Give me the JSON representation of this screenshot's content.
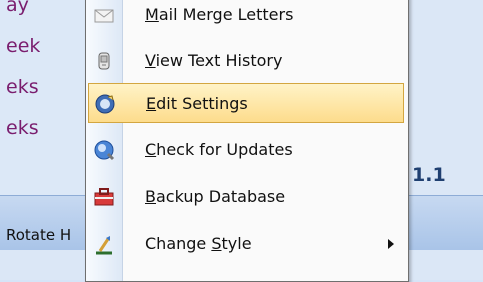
{
  "background": {
    "list_items": [
      "ay",
      "eek",
      "eks",
      "eks"
    ],
    "version_text": "1.1",
    "toolbar_label": "Rotate H"
  },
  "menu": {
    "items": [
      {
        "label_pre": "",
        "label_ul": "M",
        "label_post": "ail Merge Letters",
        "icon": "envelope-icon"
      },
      {
        "label_pre": "",
        "label_ul": "V",
        "label_post": "iew Text History",
        "icon": "history-icon"
      },
      {
        "label_pre": "",
        "label_ul": "E",
        "label_post": "dit Settings",
        "icon": "settings-icon",
        "selected": true
      },
      {
        "label_pre": "",
        "label_ul": "C",
        "label_post": "heck for Updates",
        "icon": "update-globe-icon"
      },
      {
        "label_pre": "",
        "label_ul": "B",
        "label_post": "ackup Database",
        "icon": "backup-toolbox-icon"
      },
      {
        "label_pre": "Change ",
        "label_ul": "S",
        "label_post": "tyle",
        "icon": "style-brush-icon",
        "submenu": true
      }
    ]
  },
  "colors": {
    "selected_fill": "#fddc8c",
    "selected_border": "#d3a640",
    "background_text": "#7a1d6e"
  }
}
